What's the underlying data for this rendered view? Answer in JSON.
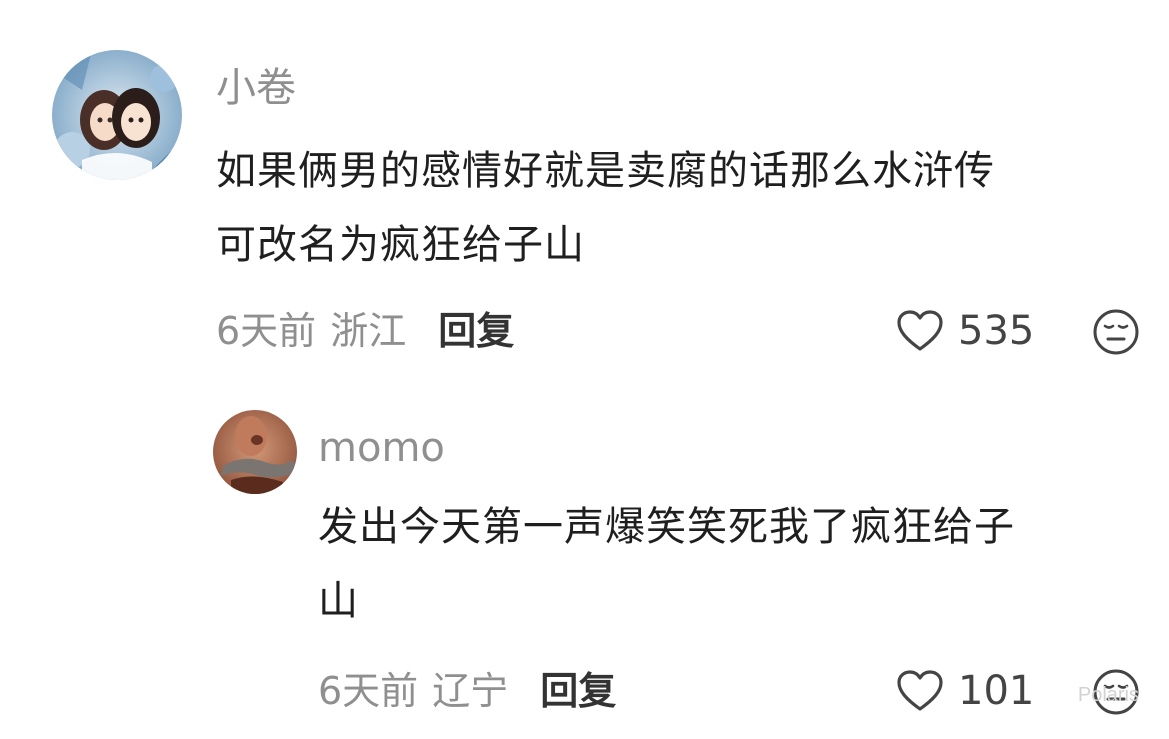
{
  "comments": [
    {
      "username": "小卷",
      "text_line1": "如果俩男的感情好就是卖腐的话那么水浒传",
      "text_line2": "可改名为疯狂给子山",
      "time": "6天前",
      "location": "浙江",
      "reply_label": "回复",
      "likes": "535"
    },
    {
      "username": "momo",
      "text_line1": "发出今天第一声爆笑笑死我了疯狂给子",
      "text_line2": "山",
      "time": "6天前",
      "location": "辽宁",
      "reply_label": "回复",
      "likes": "101"
    }
  ],
  "watermark": "Polaris",
  "colors": {
    "secondary_text": "#8f8f8f",
    "primary_text": "#1f1f1f",
    "background": "#ffffff"
  },
  "icons": {
    "like": "heart-outline-icon",
    "reaction": "emoji-face-icon"
  }
}
